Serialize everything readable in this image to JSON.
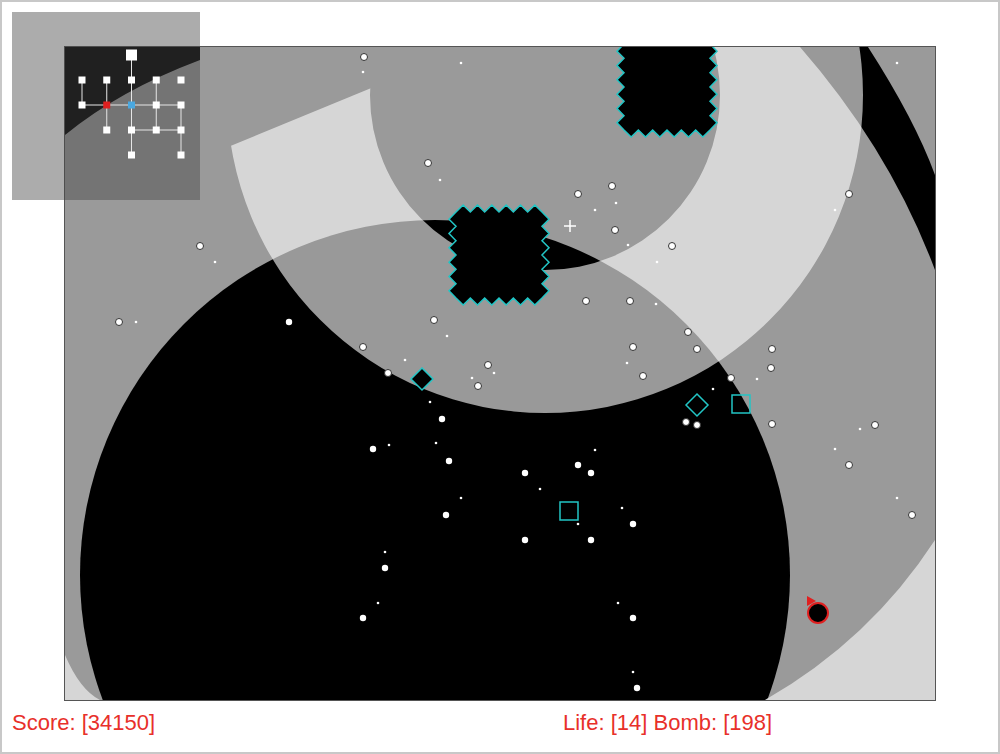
{
  "hud": {
    "score": "Score: [34150]",
    "life": "Life: [14]",
    "bomb": "Bomb: [198]"
  },
  "minimap": {
    "rooms": [
      {
        "col": 2,
        "row": 0,
        "color": "#ffffff"
      },
      {
        "col": 0,
        "row": 1,
        "color": "#ffffff"
      },
      {
        "col": 1,
        "row": 1,
        "color": "#ffffff"
      },
      {
        "col": 2,
        "row": 1,
        "color": "#ffffff"
      },
      {
        "col": 3,
        "row": 1,
        "color": "#ffffff"
      },
      {
        "col": 4,
        "row": 1,
        "color": "#ffffff"
      },
      {
        "col": 0,
        "row": 2,
        "color": "#ffffff"
      },
      {
        "col": 1,
        "row": 2,
        "color": "#e02020"
      },
      {
        "col": 2,
        "row": 2,
        "color": "#4aa8e0"
      },
      {
        "col": 3,
        "row": 2,
        "color": "#ffffff"
      },
      {
        "col": 4,
        "row": 2,
        "color": "#ffffff"
      },
      {
        "col": 1,
        "row": 3,
        "color": "#ffffff"
      },
      {
        "col": 2,
        "row": 3,
        "color": "#ffffff"
      },
      {
        "col": 3,
        "row": 3,
        "color": "#ffffff"
      },
      {
        "col": 4,
        "row": 3,
        "color": "#ffffff"
      },
      {
        "col": 2,
        "row": 4,
        "color": "#ffffff"
      },
      {
        "col": 4,
        "row": 4,
        "color": "#ffffff"
      }
    ],
    "links": [
      [
        1,
        6
      ],
      [
        2,
        7
      ],
      [
        7,
        11
      ],
      [
        0,
        3
      ],
      [
        3,
        8
      ],
      [
        8,
        12
      ],
      [
        12,
        15
      ],
      [
        4,
        9
      ],
      [
        9,
        13
      ],
      [
        10,
        14
      ],
      [
        14,
        16
      ],
      [
        6,
        7
      ],
      [
        7,
        8
      ],
      [
        8,
        9
      ],
      [
        9,
        10
      ],
      [
        12,
        13
      ],
      [
        13,
        14
      ]
    ]
  },
  "enemies": [
    {
      "kind": "spiked"
    },
    {
      "kind": "spiked"
    },
    {
      "kind": "diamond-filled"
    },
    {
      "kind": "diamond"
    },
    {
      "kind": "square"
    },
    {
      "kind": "square"
    }
  ],
  "player": {
    "kind": "ship"
  }
}
